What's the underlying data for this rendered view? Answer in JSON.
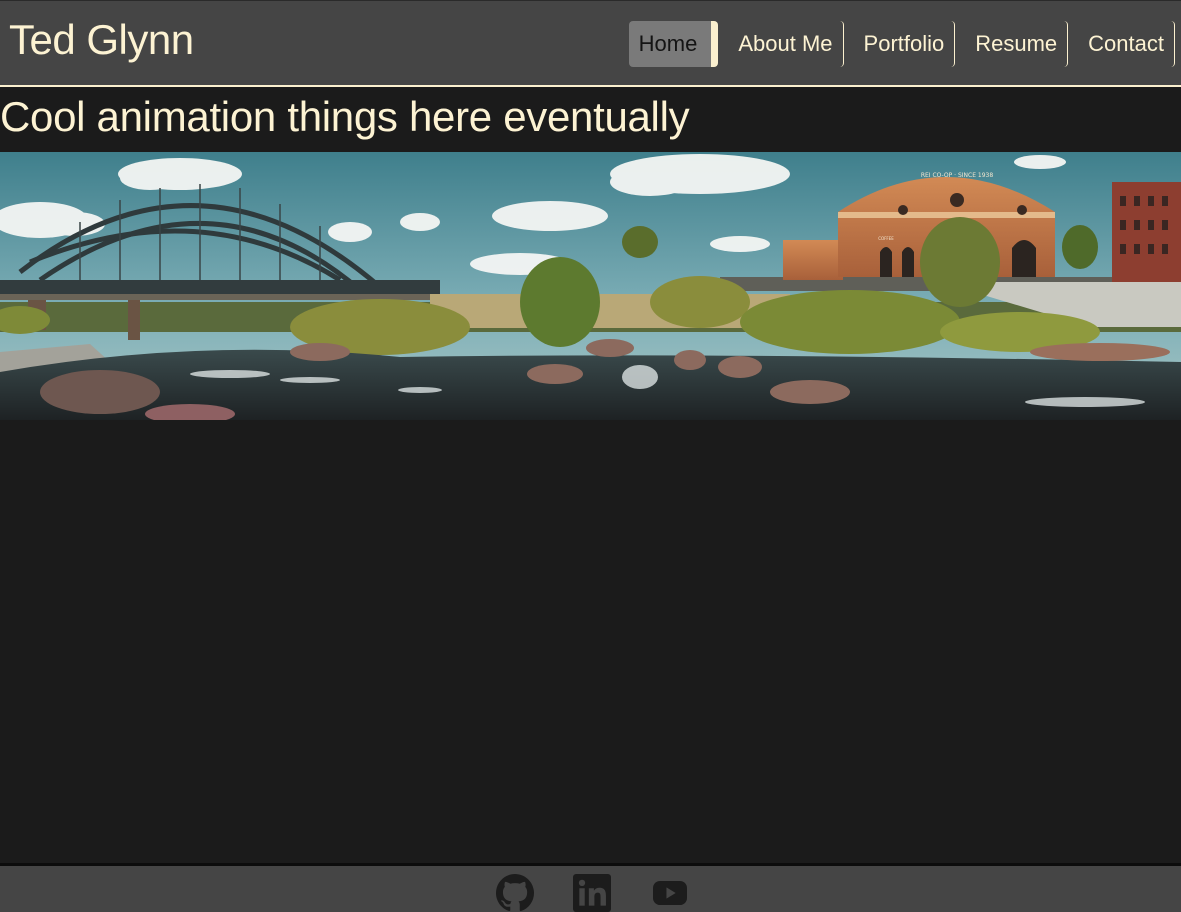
{
  "site": {
    "brand": "Ted Glynn"
  },
  "nav": {
    "items": [
      {
        "label": "Home",
        "active": true
      },
      {
        "label": "About Me",
        "active": false
      },
      {
        "label": "Portfolio",
        "active": false
      },
      {
        "label": "Resume",
        "active": false
      },
      {
        "label": "Contact",
        "active": false
      }
    ]
  },
  "main": {
    "title": "Cool animation things here eventually",
    "banner": {
      "sign": "REI CO-OP · SINCE 1938",
      "sign_small": "COFFEE"
    }
  },
  "footer": {
    "icons": [
      "github-icon",
      "linkedin-icon",
      "youtube-icon"
    ]
  },
  "colors": {
    "accent": "#fdf3d3",
    "header_bg": "#454545",
    "page_bg": "#1b1b1b",
    "active_nav_bg": "#7a7a7a",
    "footer_icon": "#1c1c1c"
  }
}
